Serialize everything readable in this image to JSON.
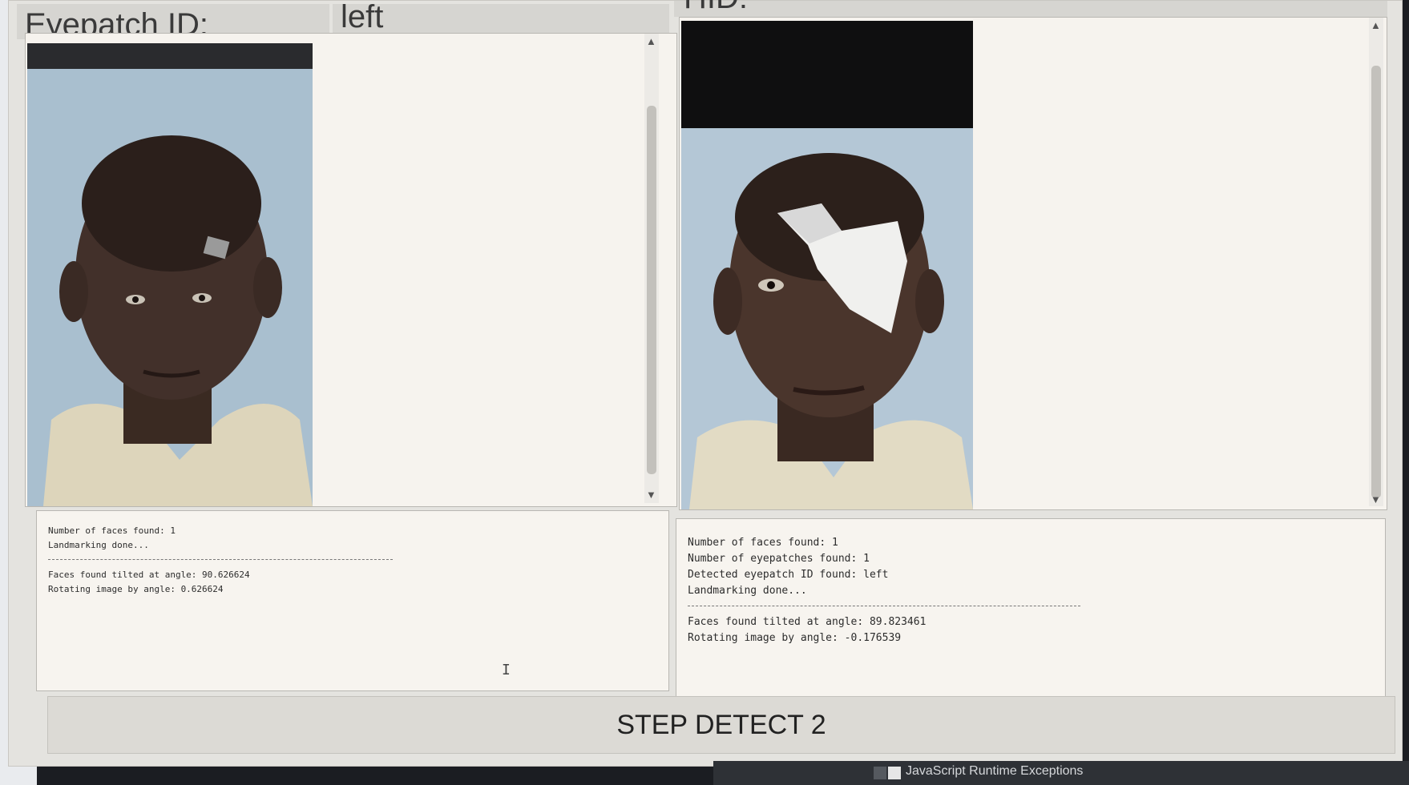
{
  "header": {
    "eyepatch_label": "Eyepatch ID:",
    "eyepatch_value": "left",
    "right_label": "HID:"
  },
  "left_log": {
    "lines_top": [
      "Number of faces found: 1",
      "Landmarking done..."
    ],
    "lines_bottom": [
      "Faces found tilted at angle: 90.626624",
      "Rotating image by angle: 0.626624"
    ]
  },
  "right_log": {
    "lines_top": [
      "Number of faces found: 1",
      "Number of eyepatches found: 1",
      "Detected eyepatch ID found: left",
      "Landmarking done..."
    ],
    "lines_bottom": [
      "Faces found tilted at angle: 89.823461",
      "Rotating image by angle: -0.176539"
    ]
  },
  "step_button_label": "STEP DETECT 2",
  "taskbar": {
    "item_label": "JavaScript Runtime Exceptions"
  }
}
